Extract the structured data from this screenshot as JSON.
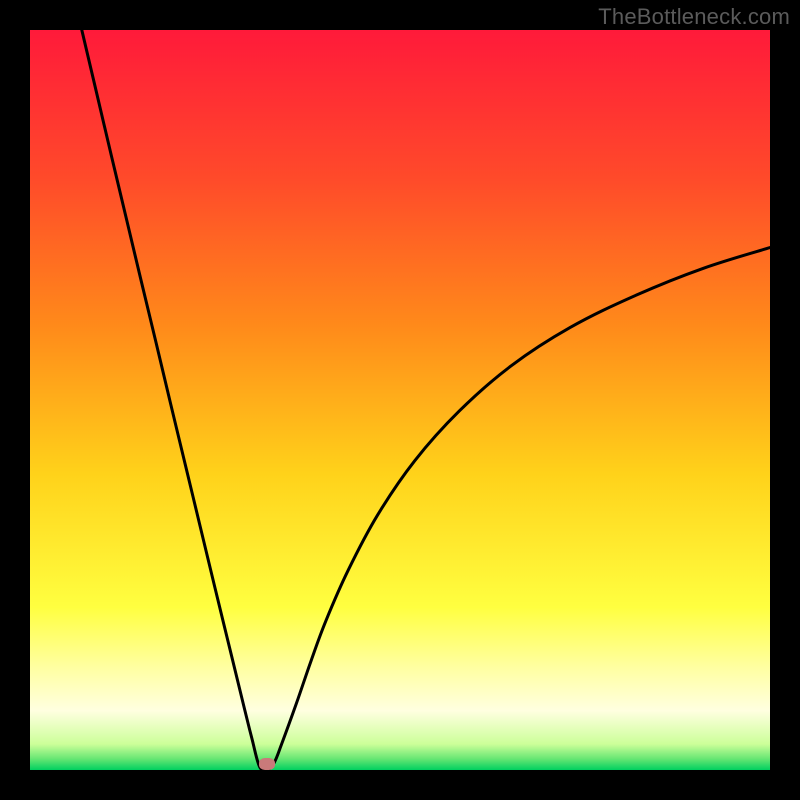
{
  "watermark": "TheBottleneck.com",
  "chart_data": {
    "type": "line",
    "title": "",
    "xlabel": "",
    "ylabel": "",
    "xlim": [
      0,
      100
    ],
    "ylim": [
      0,
      100
    ],
    "gradient_stops": [
      {
        "offset": 0.0,
        "color": "#ff1a3a"
      },
      {
        "offset": 0.2,
        "color": "#ff4a2a"
      },
      {
        "offset": 0.4,
        "color": "#ff8a1a"
      },
      {
        "offset": 0.6,
        "color": "#ffd21a"
      },
      {
        "offset": 0.78,
        "color": "#ffff40"
      },
      {
        "offset": 0.86,
        "color": "#ffffa0"
      },
      {
        "offset": 0.92,
        "color": "#ffffe0"
      },
      {
        "offset": 0.965,
        "color": "#ccff99"
      },
      {
        "offset": 0.985,
        "color": "#66e673"
      },
      {
        "offset": 1.0,
        "color": "#00d060"
      }
    ],
    "series": [
      {
        "name": "bottleneck-curve",
        "x": [
          7.0,
          9.0,
          11.0,
          13.0,
          15.0,
          17.0,
          19.0,
          21.0,
          23.0,
          25.0,
          27.0,
          29.0,
          30.0,
          31.0,
          32.0,
          33.0,
          34.0,
          36.0,
          38.0,
          40.0,
          43.0,
          47.0,
          52.0,
          58.0,
          65.0,
          73.0,
          82.0,
          91.0,
          100.0
        ],
        "y": [
          100.0,
          91.5,
          83.0,
          74.6,
          66.2,
          57.9,
          49.5,
          41.2,
          32.9,
          24.6,
          16.4,
          8.2,
          4.2,
          0.5,
          0.0,
          1.0,
          3.5,
          9.0,
          14.8,
          20.2,
          27.0,
          34.5,
          41.8,
          48.5,
          54.6,
          59.8,
          64.2,
          67.8,
          70.6
        ]
      }
    ],
    "marker": {
      "x": 32.0,
      "y": 0.8,
      "color": "#c97a7a"
    }
  }
}
